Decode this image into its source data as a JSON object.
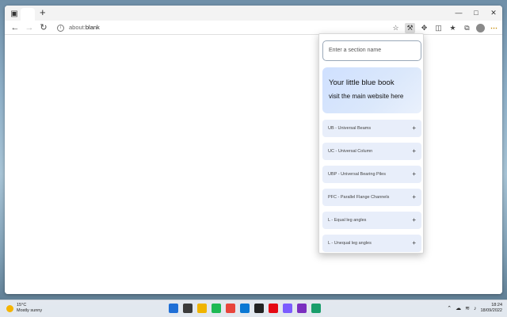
{
  "browser": {
    "address": "about:",
    "address_rest": "blank",
    "new_tab": "+",
    "window_controls": [
      "—",
      "□",
      "✕"
    ]
  },
  "popup": {
    "search_placeholder": "Enter a section name",
    "hero_title": "Your little blue book",
    "hero_link": "visit the main website here",
    "sections": [
      {
        "label": "UB - Universal Beams"
      },
      {
        "label": "UC - Universal Column"
      },
      {
        "label": "UBP - Universal Bearing Piles"
      },
      {
        "label": "PFC - Parallel Flange Channels"
      },
      {
        "label": "L - Equal leg angles"
      },
      {
        "label": "L - Unequal leg angles"
      }
    ],
    "expand_symbol": "+"
  },
  "taskbar": {
    "weather_temp": "15°C",
    "weather_desc": "Mostly sunny",
    "time": "18:24",
    "date": "18/09/2022",
    "app_colors": [
      "#1f6fd6",
      "#3b3b3b",
      "#f0b400",
      "#1db954",
      "#e8453c",
      "#0a78d4",
      "#222222",
      "#e50914",
      "#7b5cff",
      "#7b2fbf",
      "#1a9e6b"
    ]
  }
}
